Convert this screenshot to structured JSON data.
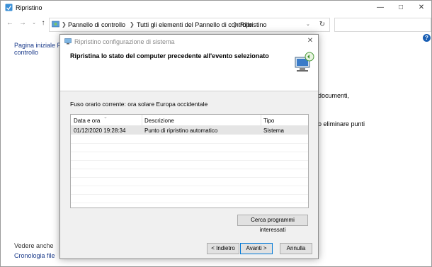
{
  "window": {
    "title": "Ripristino"
  },
  "address_bar": {
    "crumbs": [
      "Pannello di controllo",
      "Tutti gli elementi del Pannello di controllo",
      "Ripristino"
    ]
  },
  "left_pane": {
    "home_link_line1": "Pagina iniziale Pann",
    "home_link_line2": "controllo",
    "see_also": "Vedere anche",
    "file_history": "Cronologia file"
  },
  "background_fragments": {
    "line1": "documenti,",
    "line2": "o eliminare punti"
  },
  "dialog": {
    "title": "Ripristino configurazione di sistema",
    "heading": "Ripristina lo stato del computer precedente all'evento selezionato",
    "timezone": "Fuso orario corrente: ora solare Europa occidentale",
    "columns": [
      "Data e ora",
      "Descrizione",
      "Tipo"
    ],
    "rows": [
      {
        "date": "01/12/2020 19:28:34",
        "description": "Punto di ripristino automatico",
        "type": "Sistema"
      }
    ],
    "scan_button": "Cerca programmi interessati",
    "back_button": "< Indietro",
    "next_button": "Avanti >",
    "cancel_button": "Annulla"
  }
}
